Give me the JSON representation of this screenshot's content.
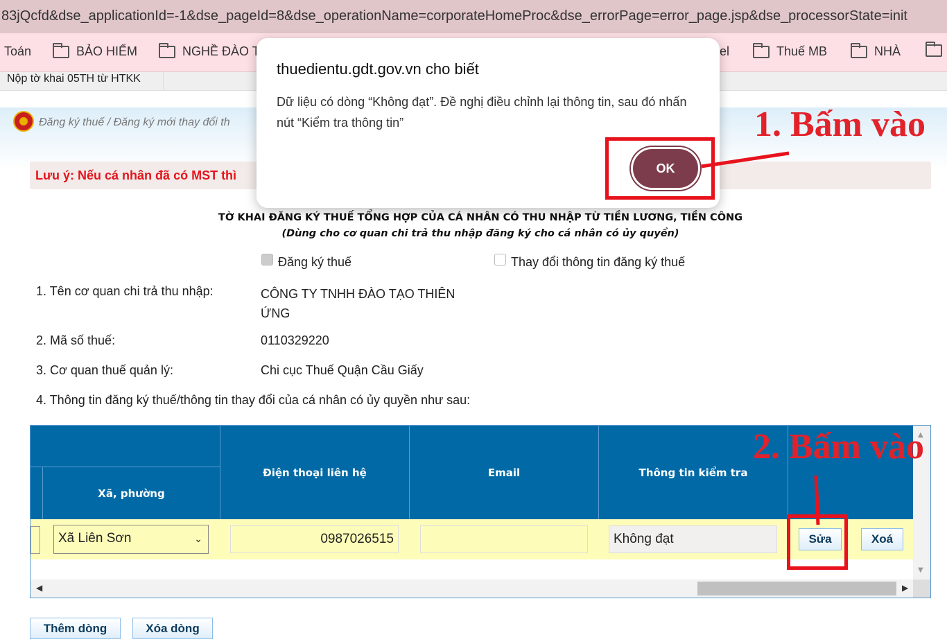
{
  "browser": {
    "url": "83jQcfd&dse_applicationId=-1&dse_pageId=8&dse_operationName=corporateHomeProc&dse_errorPage=error_page.jsp&dse_processorState=init",
    "bookmarks": [
      "Toán",
      "BẢO HIỂM",
      "NGHỀ ĐÀO T",
      "el",
      "Thuế MB",
      "NHÀ",
      ""
    ]
  },
  "page": {
    "tab": "Nộp tờ khai 05TH từ HTKK",
    "breadcrumb": "Đăng ký thuế / Đăng ký mới thay đổi th",
    "notice": "Lưu ý: Nếu cá nhân đã có MST thì",
    "form_title": "TỜ KHAI ĐĂNG KÝ THUẾ TỔNG HỢP CỦA CÁ NHÂN CÓ THU NHẬP TỪ TIỀN LƯƠNG, TIỀN CÔNG",
    "form_subtitle": "(Dùng cho cơ quan chi trả thu nhập đăng ký cho cá nhân có ủy quyền)",
    "checkbox_register": "Đăng ký thuế",
    "checkbox_register_checked": true,
    "checkbox_change": "Thay đổi thông tin đăng ký thuế",
    "checkbox_change_checked": false,
    "fields": [
      {
        "label": "1. Tên cơ quan chi trả thu nhập:",
        "value": "CÔNG TY TNHH ĐÀO TẠO THIÊN ỨNG"
      },
      {
        "label": "2. Mã số thuế:",
        "value": "0110329220"
      },
      {
        "label": "3. Cơ quan thuế quản lý:",
        "value": "Chi cục Thuế Quận Cầu Giấy"
      }
    ],
    "section4": "4. Thông tin đăng ký thuế/thông tin thay đổi của cá nhân có ủy quyền như sau:",
    "table": {
      "headers": [
        "Xã, phường",
        "Điện thoại liên hệ",
        "Email",
        "Thông tin kiểm tra"
      ],
      "row": {
        "ward": "Xã Liên Sơn",
        "phone": "0987026515",
        "email": "",
        "check": "Không đạt",
        "edit": "Sửa",
        "delete": "Xoá"
      }
    },
    "add_row": "Thêm dòng",
    "delete_row": "Xóa dòng"
  },
  "dialog": {
    "title": "thuedientu.gdt.gov.vn cho biết",
    "message": "Dữ liệu có dòng “Không đạt”. Đề nghị điều chỉnh lại thông tin, sau đó nhấn nút “Kiểm tra thông tin”",
    "ok": "OK"
  },
  "annotations": {
    "step1": "1. Bấm vào",
    "step2": "2. Bấm vào",
    "color": "#e2222b"
  }
}
